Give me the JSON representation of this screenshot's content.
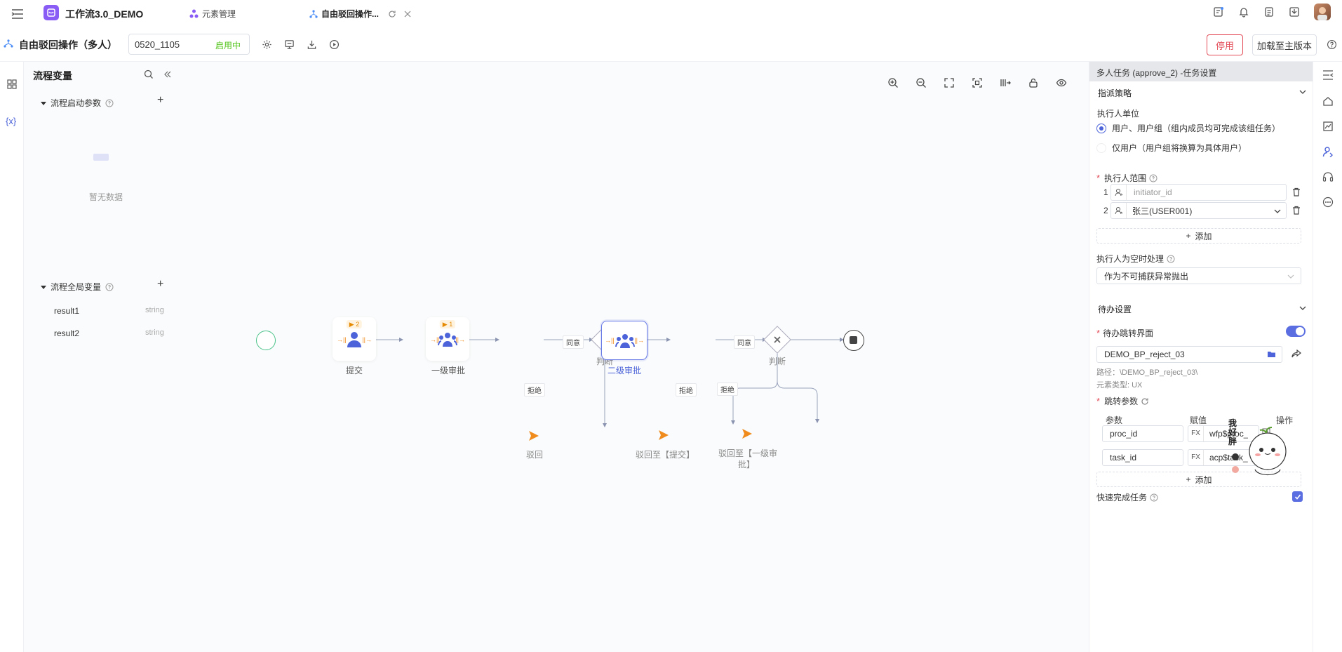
{
  "app": {
    "title": "工作流3.0_DEMO",
    "tabs": [
      {
        "label": "元素管理"
      },
      {
        "label": "自由驳回操作..."
      }
    ]
  },
  "toolbar": {
    "process_name": "自由驳回操作（多人）",
    "version": "0520_1105",
    "status": "启用中",
    "disable_button": "停用",
    "load_main_button": "加载至主版本"
  },
  "left": {
    "title": "流程变量",
    "startup_params": "流程启动参数",
    "empty_text": "暂无数据",
    "global_vars": "流程全局变量",
    "vars": [
      {
        "name": "result1",
        "type": "string"
      },
      {
        "name": "result2",
        "type": "string"
      }
    ],
    "var_icon_text": "{x}"
  },
  "flow": {
    "nodes": {
      "submit": "提交",
      "level1": "一级审批",
      "judge1": "判断",
      "level2": "二级审批",
      "judge2": "判断",
      "reject": "驳回",
      "reject_submit": "驳回至【提交】",
      "reject_level1_a": "驳回至【一级审",
      "reject_level1_b": "批】"
    },
    "badges": {
      "submit": "▶ 2",
      "level1": "▶ 1"
    },
    "edges": {
      "agree1": "同意",
      "reject1": "拒绝",
      "agree2": "同意",
      "reject2a": "拒绝",
      "reject2b": "拒绝"
    }
  },
  "panel": {
    "header": "多人任务 (approve_2) -任务设置",
    "assign_strategy": "指派策略",
    "executor_unit": "执行人单位",
    "option_group": "用户、用户组（组内成员均可完成该组任务）",
    "option_user": "仅用户（用户组将换算为具体用户）",
    "executor_range": "执行人范围",
    "range_rows": [
      {
        "index": "1",
        "value": "initiator_id"
      },
      {
        "index": "2",
        "value": "张三(USER001)"
      }
    ],
    "add_label": "添加",
    "empty_handling": "执行人为空时处理",
    "empty_handling_value": "作为不可捕获异常抛出",
    "todo_settings": "待办设置",
    "todo_jump": "待办跳转界面",
    "jump_value": "DEMO_BP_reject_03",
    "path_text": "路径：\\DEMO_BP_reject_03\\",
    "element_type": "元素类型: UX",
    "jump_params": "跳转参数",
    "param_headers": {
      "param": "参数",
      "value": "赋值",
      "action": "操作"
    },
    "params": [
      {
        "name": "proc_id",
        "fx": "FX",
        "value": "wfp$proc_"
      },
      {
        "name": "task_id",
        "fx": "FX",
        "value": "acp$task_"
      }
    ],
    "quick_complete": "快速完成任务",
    "sticker_text": "我好胖"
  },
  "colors": {
    "accent": "#5b6ee1",
    "orange": "#f08c1d",
    "green": "#52c41a",
    "danger": "#e34d59"
  }
}
